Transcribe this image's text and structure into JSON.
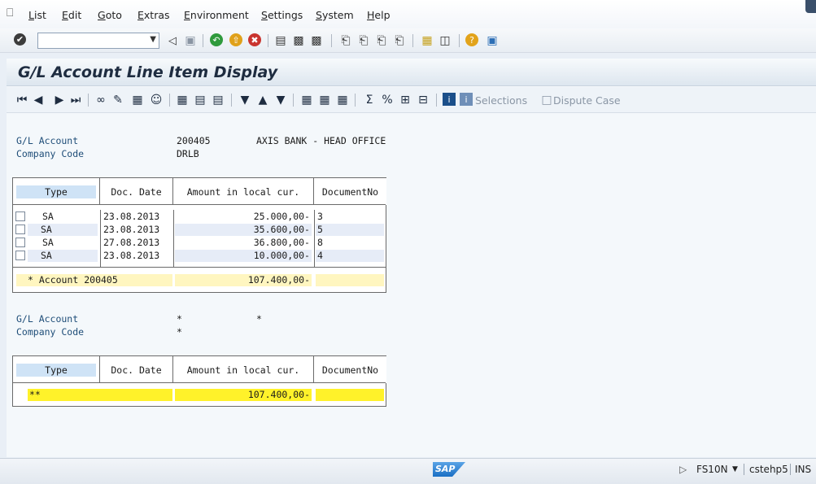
{
  "menu": {
    "items": [
      "List",
      "Edit",
      "Goto",
      "Extras",
      "Environment",
      "Settings",
      "System",
      "Help"
    ]
  },
  "toolbar": {
    "command_value": "",
    "icons": [
      "enter-icon",
      "back-nav-icon",
      "save-icon",
      "back-icon",
      "exit-icon",
      "cancel-icon",
      "print-icon",
      "find-icon",
      "find-next-icon",
      "first-page-icon",
      "prev-page-icon",
      "next-page-icon",
      "last-page-icon",
      "new-session-icon",
      "shortcut-icon",
      "help-icon",
      "customize-layout-icon"
    ]
  },
  "page": {
    "title": "G/L Account Line Item Display"
  },
  "app_toolbar": {
    "selections_label": "Selections",
    "dispute_label": "Dispute Case"
  },
  "section1": {
    "gl_label": "G/L Account",
    "gl_value": "200405",
    "gl_name": "AXIS BANK - HEAD OFFICE",
    "cc_label": "Company Code",
    "cc_value": "DRLB"
  },
  "table1": {
    "headers": [
      "Type",
      "Doc. Date",
      "Amount in local cur.",
      "DocumentNo"
    ],
    "rows": [
      {
        "type": "SA",
        "date": "23.08.2013",
        "amount": "25.000,00-",
        "doc": "3"
      },
      {
        "type": "SA",
        "date": "23.08.2013",
        "amount": "35.600,00-",
        "doc": "5"
      },
      {
        "type": "SA",
        "date": "27.08.2013",
        "amount": "36.800,00-",
        "doc": "8"
      },
      {
        "type": "SA",
        "date": "23.08.2013",
        "amount": "10.000,00-",
        "doc": "4"
      }
    ],
    "subtotal_label": "* Account 200405",
    "subtotal_amount": "107.400,00-"
  },
  "section2": {
    "gl_label": "G/L Account",
    "gl_value": "*",
    "gl_name": "*",
    "cc_label": "Company Code",
    "cc_value": "*"
  },
  "table2": {
    "headers": [
      "Type",
      "Doc. Date",
      "Amount in local cur.",
      "DocumentNo"
    ],
    "total_label": "**",
    "total_amount": "107.400,00-"
  },
  "status": {
    "transaction": "FS10N",
    "server": "cstehp5",
    "mode": "INS"
  }
}
